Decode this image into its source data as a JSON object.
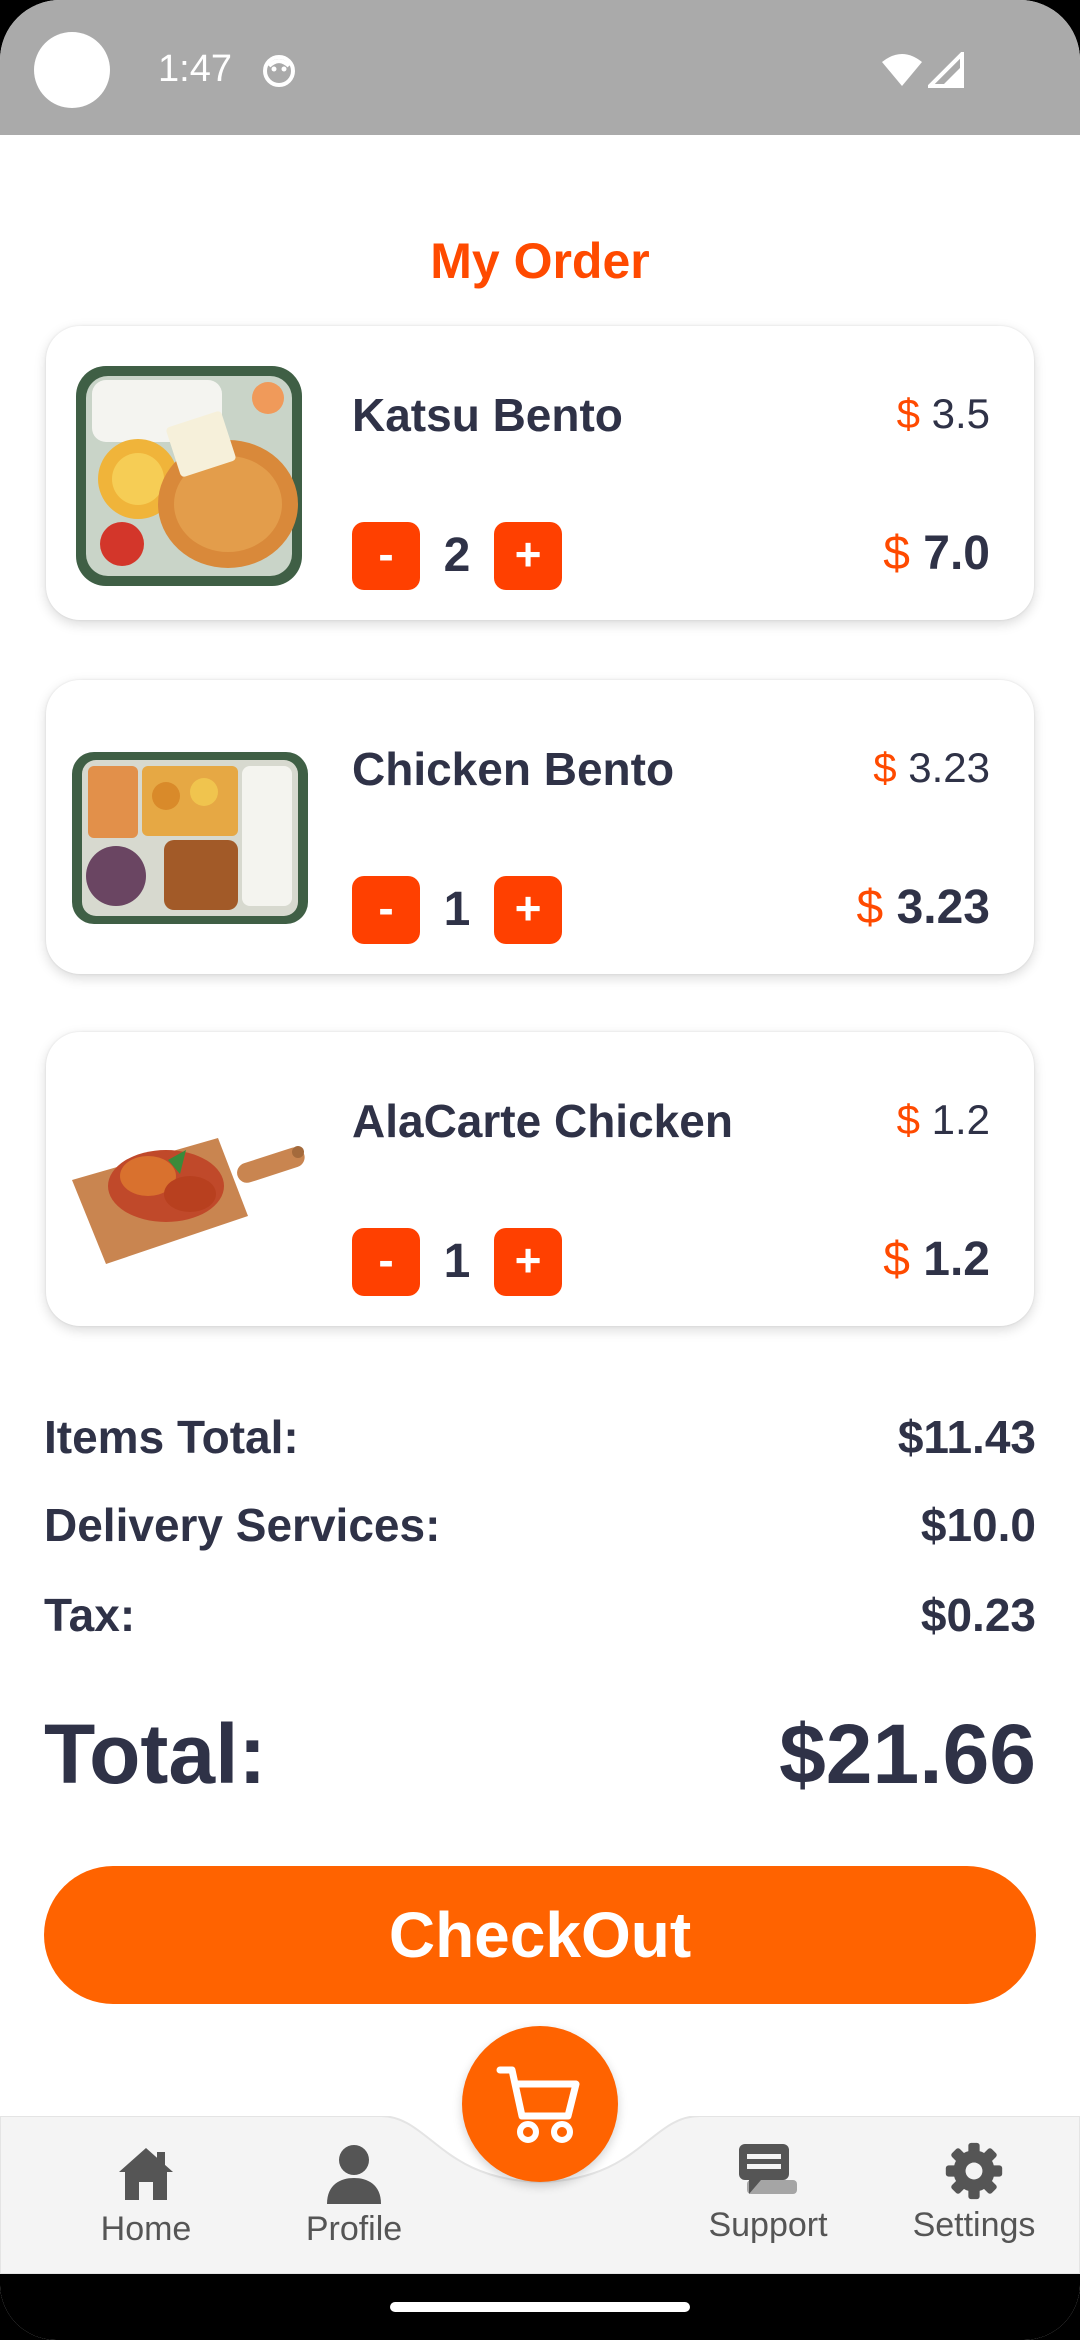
{
  "status_bar": {
    "time": "1:47"
  },
  "page": {
    "title": "My Order"
  },
  "order": {
    "items": [
      {
        "name": "Katsu Bento",
        "currency": "$",
        "unit_price": "3.5",
        "qty": "2",
        "line_total": "7.0",
        "image": "katsu-bento-image",
        "minus": "-",
        "plus": "+"
      },
      {
        "name": "Chicken Bento",
        "currency": "$",
        "unit_price": "3.23",
        "qty": "1",
        "line_total": "3.23",
        "image": "chicken-bento-image",
        "minus": "-",
        "plus": "+"
      },
      {
        "name": "AlaCarte Chicken",
        "currency": "$",
        "unit_price": "1.2",
        "qty": "1",
        "line_total": "1.2",
        "image": "alacarte-chicken-image",
        "minus": "-",
        "plus": "+"
      }
    ]
  },
  "summary": {
    "items_total_label": "Items Total:",
    "items_total_value": "$11.43",
    "delivery_label": "Delivery Services:",
    "delivery_value": "$10.0",
    "tax_label": "Tax:",
    "tax_value": "$0.23",
    "total_label": "Total:",
    "total_value": "$21.66"
  },
  "checkout": {
    "label": "CheckOut"
  },
  "nav": {
    "home": "Home",
    "profile": "Profile",
    "support": "Support",
    "settings": "Settings",
    "cart_icon": "cart-icon"
  },
  "colors": {
    "accent": "#ff4a00",
    "button": "#ff6300",
    "text": "#2f3247",
    "statusbar": "#aaaaaa"
  }
}
